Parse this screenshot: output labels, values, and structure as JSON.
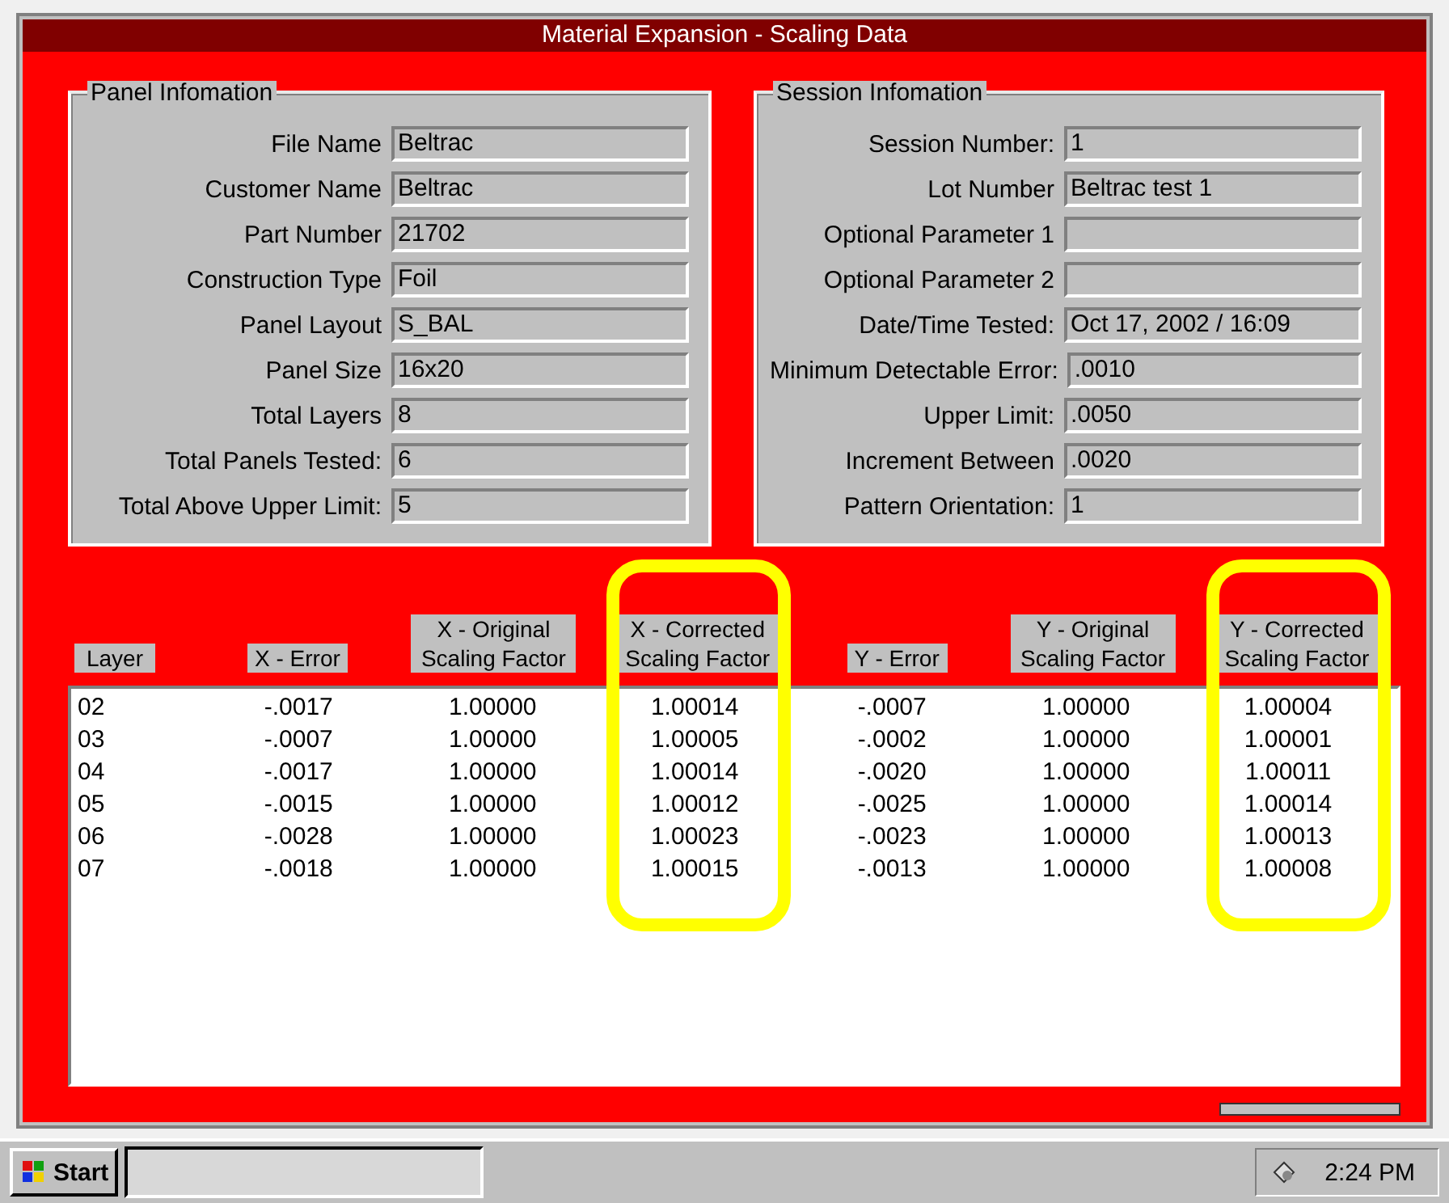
{
  "window": {
    "title": "Material Expansion - Scaling Data"
  },
  "panel_information": {
    "title": "Panel Infomation",
    "fields": [
      {
        "label": "File Name",
        "value": "Beltrac"
      },
      {
        "label": "Customer Name",
        "value": "Beltrac"
      },
      {
        "label": "Part Number",
        "value": "21702"
      },
      {
        "label": "Construction Type",
        "value": "Foil"
      },
      {
        "label": "Panel Layout",
        "value": "S_BAL"
      },
      {
        "label": "Panel Size",
        "value": "16x20"
      },
      {
        "label": "Total Layers",
        "value": "8"
      },
      {
        "label": "Total Panels Tested:",
        "value": "6"
      },
      {
        "label": "Total Above Upper Limit:",
        "value": "5"
      }
    ]
  },
  "session_information": {
    "title": "Session Infomation",
    "fields": [
      {
        "label": "Session Number:",
        "value": "1"
      },
      {
        "label": "Lot Number",
        "value": "Beltrac test 1"
      },
      {
        "label": "Optional Parameter 1"
      },
      {
        "label": "Optional Parameter 2"
      },
      {
        "label": "Date/Time Tested:",
        "value": "Oct 17, 2002 / 16:09"
      },
      {
        "label": "Minimum Detectable Error:",
        "value": ".0010"
      },
      {
        "label": "Upper Limit:",
        "value": ".0050"
      },
      {
        "label": "Increment Between",
        "value": ".0020"
      },
      {
        "label": "Pattern Orientation:",
        "value": "1"
      }
    ]
  },
  "table": {
    "columns": [
      {
        "label": "Layer",
        "highlighted": false
      },
      {
        "label": "X - Error",
        "highlighted": false
      },
      {
        "label": "X - Original Scaling Factor",
        "highlighted": false
      },
      {
        "label": "X - Corrected Scaling Factor",
        "highlighted": true
      },
      {
        "label": "Y - Error",
        "highlighted": false
      },
      {
        "label": "Y - Original Scaling Factor",
        "highlighted": false
      },
      {
        "label": "Y - Corrected Scaling Factor",
        "highlighted": true
      }
    ],
    "rows": [
      [
        "02",
        "-.0017",
        "1.00000",
        "1.00014",
        "-.0007",
        "1.00000",
        "1.00004"
      ],
      [
        "03",
        "-.0007",
        "1.00000",
        "1.00005",
        "-.0002",
        "1.00000",
        "1.00001"
      ],
      [
        "04",
        "-.0017",
        "1.00000",
        "1.00014",
        "-.0020",
        "1.00000",
        "1.00011"
      ],
      [
        "05",
        "-.0015",
        "1.00000",
        "1.00012",
        "-.0025",
        "1.00000",
        "1.00014"
      ],
      [
        "06",
        "-.0028",
        "1.00000",
        "1.00023",
        "-.0023",
        "1.00000",
        "1.00013"
      ],
      [
        "07",
        "-.0018",
        "1.00000",
        "1.00015",
        "-.0013",
        "1.00000",
        "1.00008"
      ]
    ]
  },
  "taskbar": {
    "start": "Start",
    "clock": "2:24 PM"
  }
}
